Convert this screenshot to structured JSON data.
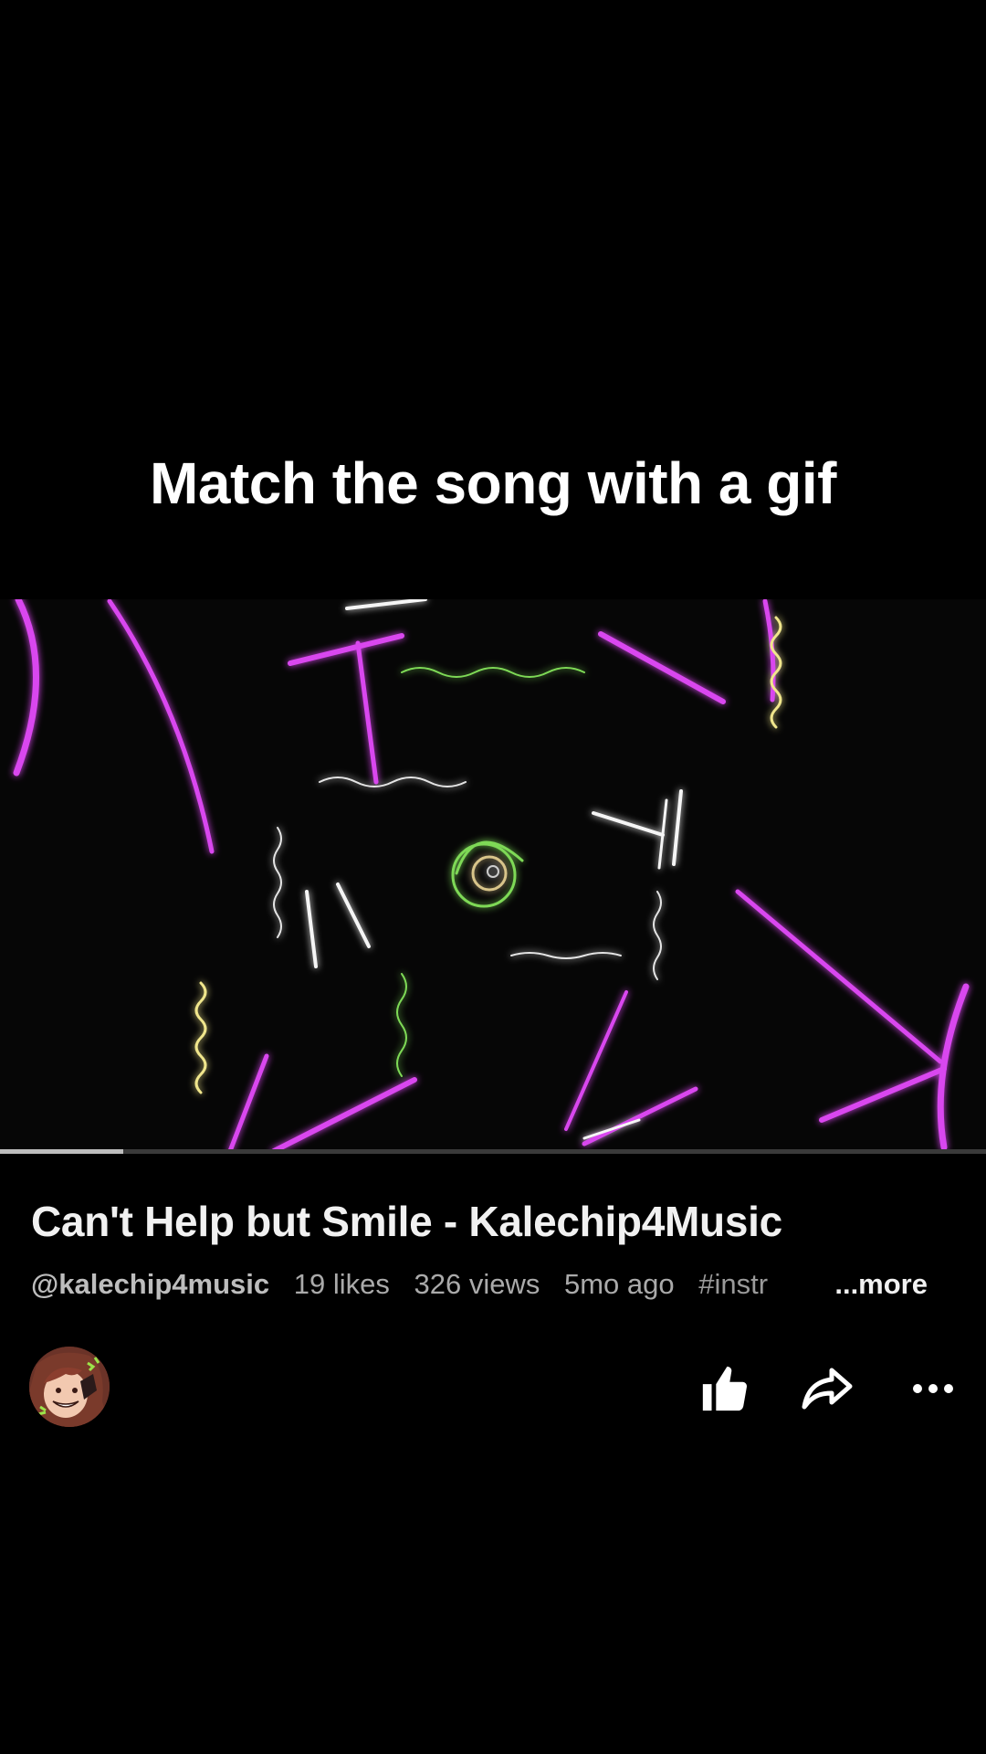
{
  "overlay": {
    "caption": "Match the song with a gif"
  },
  "video": {
    "title": "Can't Help but Smile - Kalechip4Music",
    "progress": 0.125
  },
  "meta": {
    "handle": "@kalechip4music",
    "likes": "19 likes",
    "views": "326 views",
    "age": "5mo ago",
    "hashtag": "#instr",
    "more": "...more"
  },
  "actions": {
    "like_icon": "thumbs-up-icon",
    "share_icon": "share-arrow-icon",
    "more_icon": "more-dots-icon"
  },
  "colors": {
    "background": "#000000",
    "neon_magenta": "#d946ef",
    "neon_white": "#f5f5f5",
    "neon_green": "#7ed957"
  }
}
